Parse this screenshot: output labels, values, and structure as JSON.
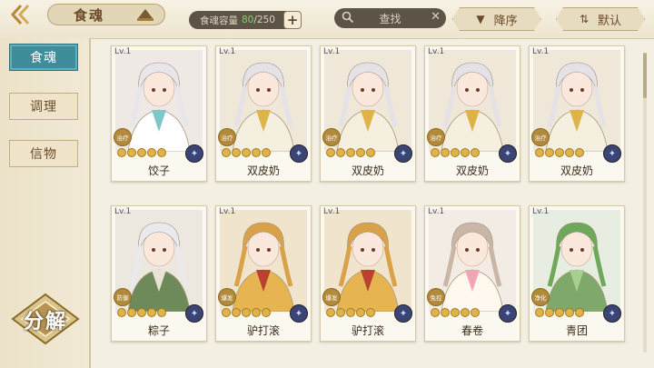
{
  "header": {
    "title": "食魂",
    "capacity_label": "食魂容量",
    "capacity_current": "80",
    "capacity_max": "/250",
    "capacity_plus": "+",
    "search_placeholder": "查找",
    "sort_order_label": "降序",
    "sort_default_label": "默认"
  },
  "sidebar": {
    "tabs": [
      {
        "label": "食魂",
        "active": true
      },
      {
        "label": "调理",
        "active": false
      },
      {
        "label": "信物",
        "active": false
      }
    ],
    "decompose_label": "分解"
  },
  "cards": [
    {
      "level": "Lv.1",
      "name": "饺子",
      "role": "治疗",
      "stars": 5,
      "theme": "white"
    },
    {
      "level": "Lv.1",
      "name": "双皮奶",
      "role": "治疗",
      "stars": 5,
      "theme": "straw"
    },
    {
      "level": "Lv.1",
      "name": "双皮奶",
      "role": "治疗",
      "stars": 5,
      "theme": "straw"
    },
    {
      "level": "Lv.1",
      "name": "双皮奶",
      "role": "治疗",
      "stars": 5,
      "theme": "straw"
    },
    {
      "level": "Lv.1",
      "name": "双皮奶",
      "role": "治疗",
      "stars": 5,
      "theme": "straw"
    },
    {
      "level": "Lv.1",
      "name": "粽子",
      "role": "防御",
      "stars": 5,
      "theme": "green-white"
    },
    {
      "level": "Lv.1",
      "name": "驴打滚",
      "role": "爆发",
      "stars": 5,
      "theme": "gold"
    },
    {
      "level": "Lv.1",
      "name": "驴打滚",
      "role": "爆发",
      "stars": 5,
      "theme": "gold"
    },
    {
      "level": "Lv.1",
      "name": "春卷",
      "role": "免控",
      "stars": 5,
      "theme": "flower"
    },
    {
      "level": "Lv.1",
      "name": "青团",
      "role": "净化",
      "stars": 5,
      "theme": "green"
    }
  ],
  "colors": {
    "accent": "#3f8d9a",
    "gold": "#e0b34a",
    "capacity_value": "#7fd36b"
  },
  "icons": [
    "back-arrow-icon",
    "hat-icon",
    "search-icon",
    "clear-icon",
    "sort-down-icon",
    "sort-default-icon",
    "element-icon"
  ]
}
